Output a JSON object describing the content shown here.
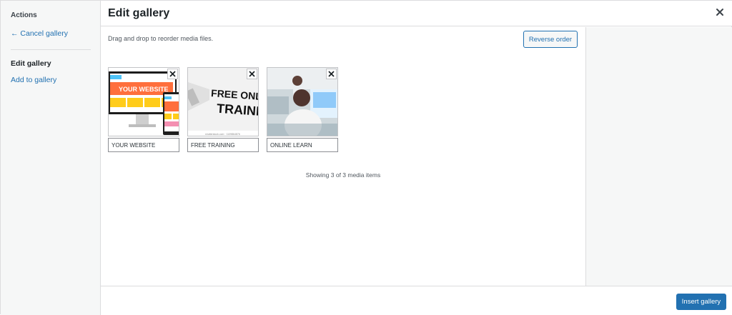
{
  "sidebar": {
    "heading": "Actions",
    "cancel_label": "← Cancel gallery",
    "items": [
      {
        "label": "Edit gallery",
        "active": true
      },
      {
        "label": "Add to gallery",
        "active": false
      }
    ]
  },
  "header": {
    "title": "Edit gallery",
    "close_icon": "close-icon"
  },
  "main": {
    "instructions": "Drag and drop to reorder media files.",
    "reverse_label": "Reverse order",
    "items": [
      {
        "caption": "YOUR WEBSITE",
        "image_text": "YOUR WEBSITE"
      },
      {
        "caption": "FREE TRAINING",
        "image_text_line1": "FREE ONLIN",
        "image_text_line2": "TRAINI",
        "image_credit": "shutterstock.com · 1109864876"
      },
      {
        "caption": "ONLINE LEARN"
      }
    ],
    "status": "Showing 3 of 3 media items"
  },
  "footer": {
    "insert_label": "Insert gallery"
  },
  "colors": {
    "accent": "#2271b1",
    "sidebar_bg": "#f6f7f7",
    "border": "#dcdcde"
  }
}
